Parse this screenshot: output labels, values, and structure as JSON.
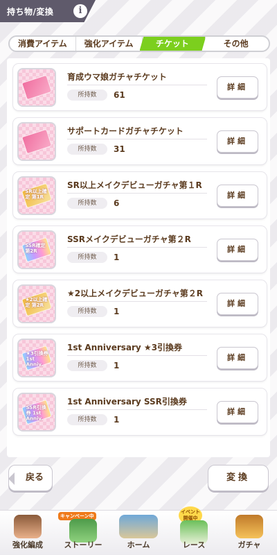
{
  "header": {
    "title": "持ち物/変換",
    "info_label": "i"
  },
  "tabs": [
    {
      "label": "消費アイテム",
      "active": false
    },
    {
      "label": "強化アイテム",
      "active": false
    },
    {
      "label": "チケット",
      "active": true
    },
    {
      "label": "その他",
      "active": false
    }
  ],
  "owned_label": "所持数",
  "detail_label": "詳細",
  "items": [
    {
      "name": "育成ウマ娘ガチャチケット",
      "count": "61",
      "ticket": "pink",
      "ticket_text": ""
    },
    {
      "name": "サポートカードガチャチケット",
      "count": "31",
      "ticket": "pink",
      "ticket_text": ""
    },
    {
      "name": "SR以上メイクデビューガチャ第１R",
      "count": "6",
      "ticket": "gold",
      "ticket_text": "SR以上確定 第1R"
    },
    {
      "name": "SSRメイクデビューガチャ第２R",
      "count": "1",
      "ticket": "rainbow",
      "ticket_text": "SSR確定 第2R"
    },
    {
      "name": "★2以上メイクデビューガチャ第２R",
      "count": "1",
      "ticket": "gold",
      "ticket_text": "★2以上確定 第2R"
    },
    {
      "name": "1st Anniversary ★3引換券",
      "count": "1",
      "ticket": "rainbow",
      "ticket_text": "★3引換券 1st Anniv."
    },
    {
      "name": "1st Anniversary SSR引換券",
      "count": "1",
      "ticket": "rainbow",
      "ticket_text": "SSR引換券 1st Anniv."
    }
  ],
  "buttons": {
    "back": "戻る",
    "convert": "変換"
  },
  "nav": [
    {
      "label": "強化編成",
      "badge": ""
    },
    {
      "label": "ストーリー",
      "badge": "キャンペーン中"
    },
    {
      "label": "ホーム",
      "badge": ""
    },
    {
      "label": "レース",
      "badge": "イベント開催中"
    },
    {
      "label": "ガチャ",
      "badge": ""
    }
  ],
  "colors": {
    "accent_green": "#7ccf1e",
    "header_bg": "#5f5a6b",
    "text_brown": "#5b3b1f"
  }
}
